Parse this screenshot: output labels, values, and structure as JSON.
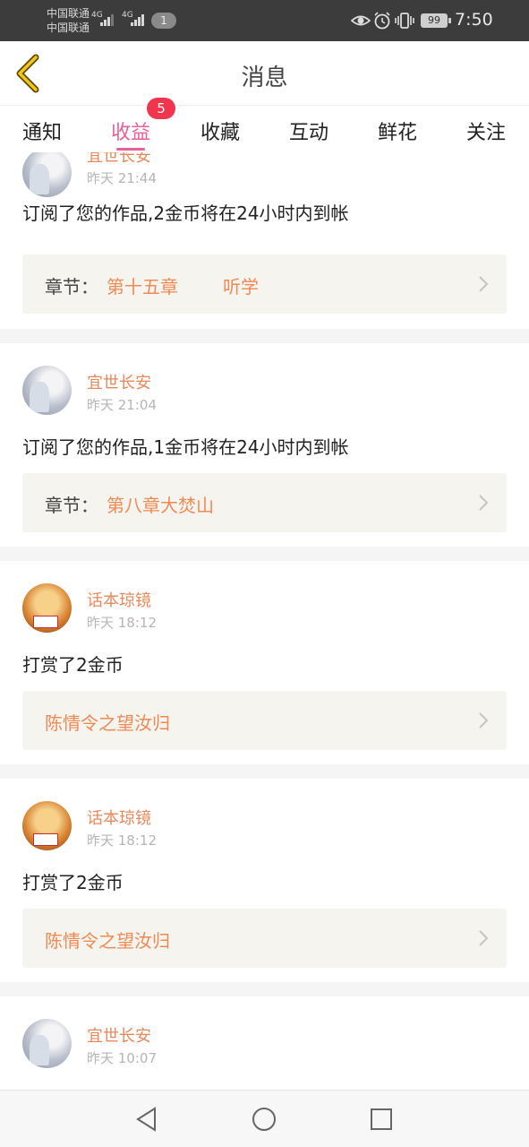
{
  "status_bar": {
    "carrier_1": "中国联通",
    "carrier_2": "中国联通",
    "net_1": "4G",
    "net_2": "4G",
    "notification_count": "1",
    "battery": "99",
    "time": "7:50"
  },
  "header": {
    "title": "消息",
    "back_icon": "chevron-left-icon"
  },
  "tabs": {
    "items": [
      {
        "label": "通知"
      },
      {
        "label": "收益"
      },
      {
        "label": "收藏"
      },
      {
        "label": "互动"
      },
      {
        "label": "鲜花"
      },
      {
        "label": "关注"
      }
    ],
    "active_index": 1,
    "badge": "5"
  },
  "messages": [
    {
      "user": "宜世长安",
      "time": "昨天 21:44",
      "text": "订阅了您的作品,2金币将在24小时内到帐",
      "link_prefix": "章节：",
      "link_text": "第十五章",
      "link_text_2": "听学"
    },
    {
      "user": "宜世长安",
      "time": "昨天 21:04",
      "text": "订阅了您的作品,1金币将在24小时内到帐",
      "link_prefix": "章节：",
      "link_text": "第八章大焚山"
    },
    {
      "user": "话本琼镜",
      "time": "昨天 18:12",
      "text": "打赏了2金币",
      "link_text": "陈情令之望汝归"
    },
    {
      "user": "话本琼镜",
      "time": "昨天 18:12",
      "text": "打赏了2金币",
      "link_text": "陈情令之望汝归"
    },
    {
      "user": "宜世长安",
      "time": "昨天 10:07"
    }
  ],
  "colors": {
    "accent": "#e8609a",
    "badge": "#f0354d",
    "username": "#e8895a",
    "link": "#ef8a55",
    "link_bg": "#f5f4ef"
  }
}
